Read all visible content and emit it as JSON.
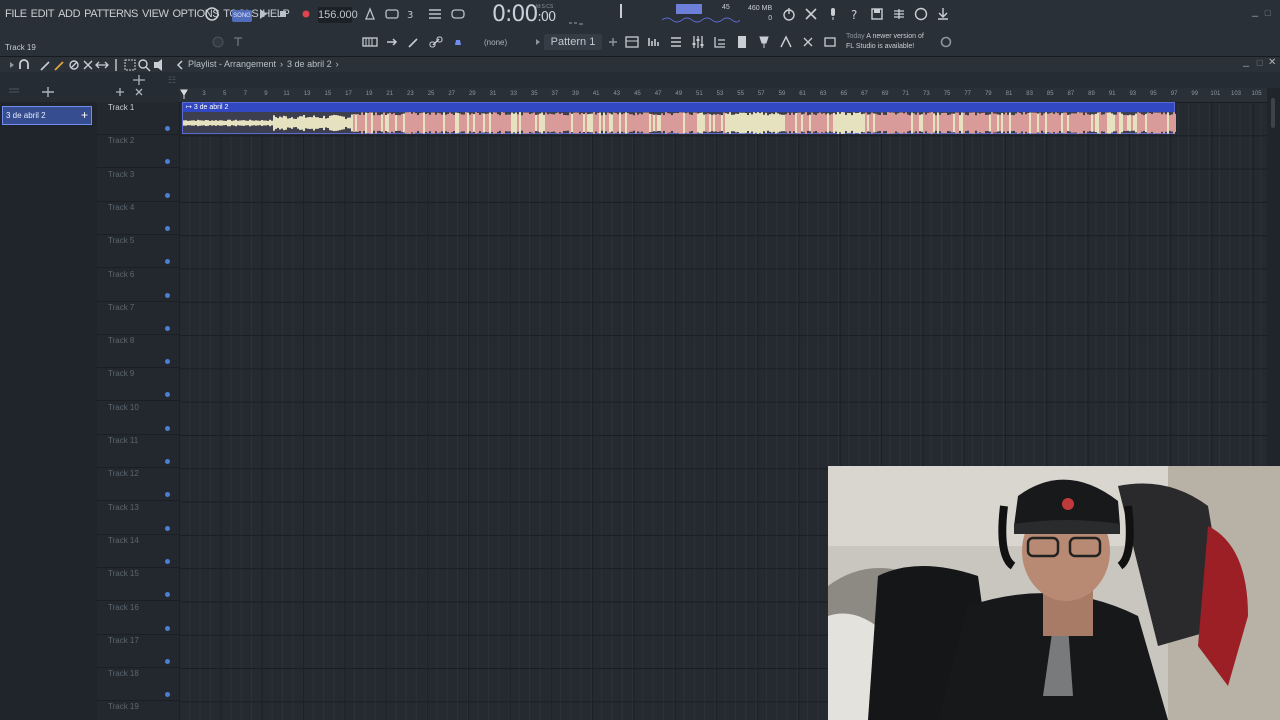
{
  "menu": [
    "FILE",
    "EDIT",
    "ADD",
    "PATTERNS",
    "VIEW",
    "OPTIONS",
    "TOOLS",
    "HELP"
  ],
  "hint": "Track 19",
  "transport": {
    "mode": "SONG",
    "tempo": "156.000",
    "time": "0:00",
    "time_small": ":00",
    "time_label": "M:S:CS"
  },
  "monitor": {
    "cpu_value": "45",
    "memory": "460 MB",
    "polyphony": "0"
  },
  "snap": "(none)",
  "pattern": "Pattern 1",
  "news": {
    "today": "Today",
    "line1": "A newer version of",
    "line2": "FL Studio is available!"
  },
  "playlist": {
    "title": "Playlist - Arrangement",
    "arrangement": "3 de abril 2"
  },
  "picker": {
    "selected": "3 de abril 2"
  },
  "clip": {
    "name": "3 de abril 2"
  },
  "ruler_labels": [
    "3",
    "5",
    "7",
    "9",
    "11",
    "13",
    "15",
    "17",
    "19",
    "21",
    "23",
    "25",
    "27",
    "29",
    "31",
    "33",
    "35",
    "37",
    "39",
    "41",
    "43",
    "45",
    "47",
    "49",
    "51",
    "53",
    "55",
    "57",
    "59",
    "61",
    "63",
    "65",
    "67",
    "69",
    "71",
    "73",
    "75",
    "77",
    "79",
    "81",
    "83",
    "85",
    "87",
    "89",
    "91",
    "93",
    "95",
    "97",
    "99",
    "101",
    "103",
    "105"
  ],
  "tracks": [
    "Track 1",
    "Track 2",
    "Track 3",
    "Track 4",
    "Track 5",
    "Track 6",
    "Track 7",
    "Track 8",
    "Track 9",
    "Track 10",
    "Track 11",
    "Track 12",
    "Track 13",
    "Track 14",
    "Track 15",
    "Track 16",
    "Track 17",
    "Track 18",
    "Track 19"
  ],
  "colors": {
    "accent": "#5b6ad2",
    "clip_header": "#3248c3",
    "waveform_light": "#e6e2c0",
    "waveform_pink": "#d99a9a"
  }
}
